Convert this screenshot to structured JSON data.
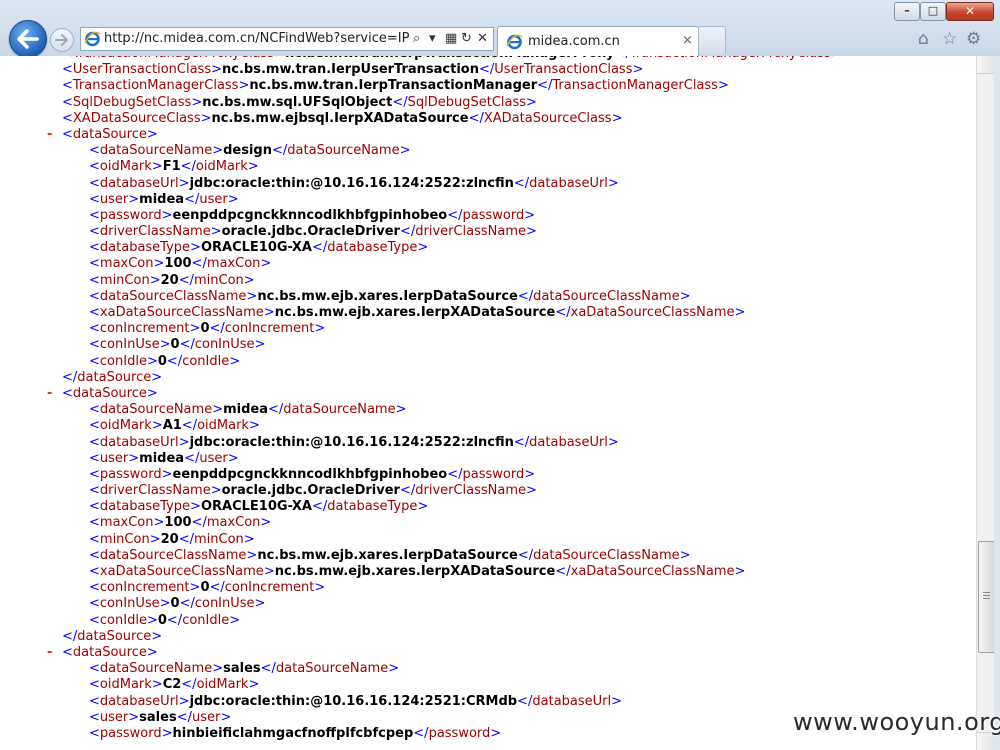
{
  "browser": {
    "url": "http://nc.midea.com.cn/NCFindWeb?service=IPreAle",
    "tab_title": "midea.com.cn",
    "tab_close": "×",
    "search_glyph": "⌕",
    "dropdown_glyph": "▾",
    "compat_glyph": "▦",
    "refresh_glyph": "↻",
    "stop_glyph": "✕",
    "minimize_glyph": "–",
    "maximize_glyph": "□",
    "close_glyph": "✕",
    "home_glyph": "⌂",
    "favorites_glyph": "☆",
    "tools_glyph": "⚙",
    "icons": [
      "back-arrow-icon",
      "forward-arrow-icon",
      "ie-logo-icon",
      "search-icon",
      "compatibility-icon",
      "refresh-icon",
      "stop-icon",
      "home-icon",
      "favorites-star-icon",
      "tools-gear-icon"
    ]
  },
  "xml": {
    "minus_glyph": "-",
    "lines": [
      {
        "indent": 1,
        "tag": "TransactionManagerProxyClass",
        "value": "nc.bs.mw.tran.IerpTransactionManagerProxy"
      },
      {
        "indent": 1,
        "tag": "UserTransactionClass",
        "value": "nc.bs.mw.tran.IerpUserTransaction"
      },
      {
        "indent": 1,
        "tag": "TransactionManagerClass",
        "value": "nc.bs.mw.tran.IerpTransactionManager"
      },
      {
        "indent": 1,
        "tag": "SqlDebugSetClass",
        "value": "nc.bs.mw.sql.UFSqlObject"
      },
      {
        "indent": 1,
        "tag": "XADataSourceClass",
        "value": "nc.bs.mw.ejbsql.IerpXADataSource"
      },
      {
        "indent": 1,
        "tag": "dataSource",
        "kind": "open",
        "collapse": true
      },
      {
        "indent": 2,
        "tag": "dataSourceName",
        "value": "design"
      },
      {
        "indent": 2,
        "tag": "oidMark",
        "value": "F1"
      },
      {
        "indent": 2,
        "tag": "databaseUrl",
        "value": "jdbc:oracle:thin:@10.16.16.124:2522:zlncfin"
      },
      {
        "indent": 2,
        "tag": "user",
        "value": "midea"
      },
      {
        "indent": 2,
        "tag": "password",
        "value": "eenpddpcgnckknncodlkhbfgpinhobeo"
      },
      {
        "indent": 2,
        "tag": "driverClassName",
        "value": "oracle.jdbc.OracleDriver"
      },
      {
        "indent": 2,
        "tag": "databaseType",
        "value": "ORACLE10G-XA"
      },
      {
        "indent": 2,
        "tag": "maxCon",
        "value": "100"
      },
      {
        "indent": 2,
        "tag": "minCon",
        "value": "20"
      },
      {
        "indent": 2,
        "tag": "dataSourceClassName",
        "value": "nc.bs.mw.ejb.xares.IerpDataSource"
      },
      {
        "indent": 2,
        "tag": "xaDataSourceClassName",
        "value": "nc.bs.mw.ejb.xares.IerpXADataSource"
      },
      {
        "indent": 2,
        "tag": "conIncrement",
        "value": "0"
      },
      {
        "indent": 2,
        "tag": "conInUse",
        "value": "0"
      },
      {
        "indent": 2,
        "tag": "conIdle",
        "value": "0"
      },
      {
        "indent": 1,
        "tag": "dataSource",
        "kind": "close"
      },
      {
        "indent": 1,
        "tag": "dataSource",
        "kind": "open",
        "collapse": true
      },
      {
        "indent": 2,
        "tag": "dataSourceName",
        "value": "midea"
      },
      {
        "indent": 2,
        "tag": "oidMark",
        "value": "A1"
      },
      {
        "indent": 2,
        "tag": "databaseUrl",
        "value": "jdbc:oracle:thin:@10.16.16.124:2522:zlncfin"
      },
      {
        "indent": 2,
        "tag": "user",
        "value": "midea"
      },
      {
        "indent": 2,
        "tag": "password",
        "value": "eenpddpcgnckknncodlkhbfgpinhobeo"
      },
      {
        "indent": 2,
        "tag": "driverClassName",
        "value": "oracle.jdbc.OracleDriver"
      },
      {
        "indent": 2,
        "tag": "databaseType",
        "value": "ORACLE10G-XA"
      },
      {
        "indent": 2,
        "tag": "maxCon",
        "value": "100"
      },
      {
        "indent": 2,
        "tag": "minCon",
        "value": "20"
      },
      {
        "indent": 2,
        "tag": "dataSourceClassName",
        "value": "nc.bs.mw.ejb.xares.IerpDataSource"
      },
      {
        "indent": 2,
        "tag": "xaDataSourceClassName",
        "value": "nc.bs.mw.ejb.xares.IerpXADataSource"
      },
      {
        "indent": 2,
        "tag": "conIncrement",
        "value": "0"
      },
      {
        "indent": 2,
        "tag": "conInUse",
        "value": "0"
      },
      {
        "indent": 2,
        "tag": "conIdle",
        "value": "0"
      },
      {
        "indent": 1,
        "tag": "dataSource",
        "kind": "close"
      },
      {
        "indent": 1,
        "tag": "dataSource",
        "kind": "open",
        "collapse": true
      },
      {
        "indent": 2,
        "tag": "dataSourceName",
        "value": "sales"
      },
      {
        "indent": 2,
        "tag": "oidMark",
        "value": "C2"
      },
      {
        "indent": 2,
        "tag": "databaseUrl",
        "value": "jdbc:oracle:thin:@10.16.16.124:2521:CRMdb"
      },
      {
        "indent": 2,
        "tag": "user",
        "value": "sales"
      },
      {
        "indent": 2,
        "tag": "password",
        "value": "hinbieificlahmgacfnoffplfcbfcpep"
      }
    ]
  },
  "watermark": "www.wooyun.org",
  "colors": {
    "tag": "#990000",
    "bracket": "#0000ff",
    "value": "#000000",
    "collapse_minus": "#e0271b"
  }
}
